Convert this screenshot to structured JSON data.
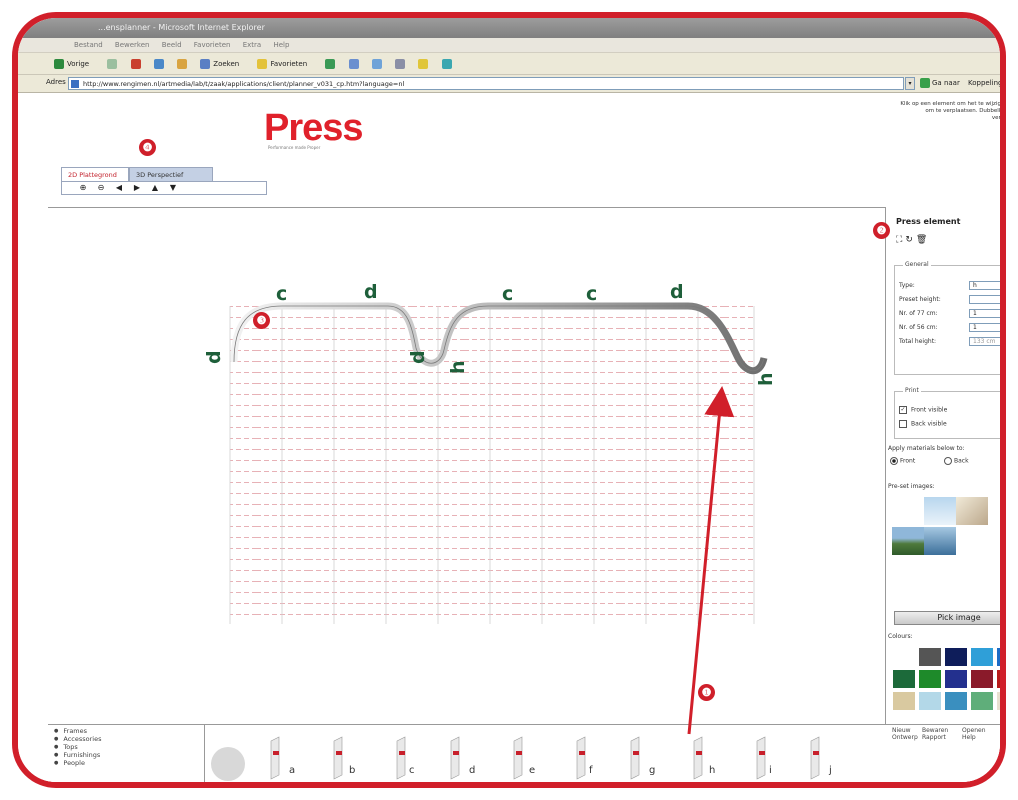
{
  "browser": {
    "title": "...ensplanner - Microsoft Internet Explorer",
    "menu": [
      "Bestand",
      "Bewerken",
      "Beeld",
      "Favorieten",
      "Extra",
      "Help"
    ],
    "toolbar": {
      "back": "Vorige",
      "search": "Zoeken",
      "favorites": "Favorieten"
    },
    "address_label": "Adres",
    "address": "http://www.rengimen.nl/artmedia/lab/t/zaak/applications/client/planner_v031_cp.htm?language=nl",
    "go": "Ga naar",
    "links": "Koppelingen"
  },
  "header": {
    "logo": "Press",
    "tagline": "Performance made Proper",
    "note": "Klik op een element om het te wijzigen, sleep om te verplaatsen. Dubbelklik om te verwijderen."
  },
  "tabs": [
    {
      "label": "2D Plattegrond",
      "active": true
    },
    {
      "label": "3D Perspectief",
      "active": false
    }
  ],
  "design": {
    "labels": [
      "d",
      "c",
      "d",
      "d",
      "c",
      "c",
      "d",
      "h",
      "h"
    ]
  },
  "panel": {
    "title": "Press element",
    "general": {
      "legend": "General",
      "rows": [
        {
          "label": "Type:",
          "value": "h"
        },
        {
          "label": "Preset height:",
          "value": ""
        },
        {
          "label": "Nr. of 77 cm:",
          "value": "1"
        },
        {
          "label": "Nr. of 56 cm:",
          "value": "1"
        },
        {
          "label": "Total height:",
          "value": "133 cm"
        }
      ]
    },
    "print": {
      "legend": "Print",
      "front_visible": "Front visible",
      "back_visible": "Back visible",
      "apply_label": "Apply materials below to:",
      "front": "Front",
      "back": "Back"
    },
    "preset_images_label": "Pre-set images:",
    "pick_button": "Pick image",
    "colours_label": "Colours:",
    "colours": [
      "#ffffff",
      "#555555",
      "#0e1d5a",
      "#2f9fd8",
      "#1c6cc6",
      "#1c6a3a",
      "#1e8a2a",
      "#23308e",
      "#8a1a2a",
      "#b81a1a",
      "#d9c9a0",
      "#b3d8e8",
      "#3a8fbf",
      "#5fae7a",
      "#e8e0d0"
    ]
  },
  "bottom": {
    "categories": [
      "Frames",
      "Accessories",
      "Tops",
      "Furnishings",
      "People"
    ],
    "elements": [
      "a",
      "b",
      "c",
      "d",
      "e",
      "f",
      "g",
      "h",
      "i",
      "j"
    ],
    "actions": [
      "Nieuw Ontwerp",
      "Bewaren Rapport",
      "Openen Help"
    ]
  },
  "annotations": [
    "❶",
    "❷",
    "❸",
    "❹"
  ]
}
